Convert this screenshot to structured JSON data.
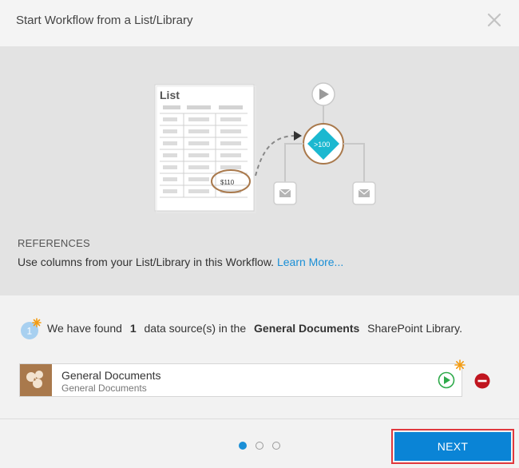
{
  "dialog": {
    "title": "Start Workflow from a List/Library",
    "close_icon": "close-icon"
  },
  "banner": {
    "illustration": {
      "list_title": "List",
      "cell_value": "$110",
      "condition_label": ">100",
      "icons": [
        "play-icon",
        "mail-icon",
        "mail-icon"
      ]
    },
    "references_heading": "REFERENCES",
    "references_text": "Use columns from your List/Library in this Workflow.",
    "learn_more": "Learn More..."
  },
  "found": {
    "step_number": "1",
    "prefix": "We have found",
    "count": "1",
    "middle": "data source(s) in the",
    "library_name": "General Documents",
    "suffix": "SharePoint Library."
  },
  "data_source": {
    "name": "General Documents",
    "subtitle": "General Documents",
    "icon": "library-icon",
    "action_icon": "play-icon",
    "remove_icon": "remove-icon"
  },
  "pager": {
    "current_page": 1,
    "total_pages": 3
  },
  "footer": {
    "next_label": "NEXT"
  },
  "colors": {
    "accent": "#0a84d6",
    "highlight_border": "#e0393e",
    "teal_diamond": "#1bb8d0",
    "library_icon_bg": "#a9794c",
    "required_star": "#f39c12",
    "play_green": "#2eaa4a",
    "remove_red": "#c0151f"
  }
}
